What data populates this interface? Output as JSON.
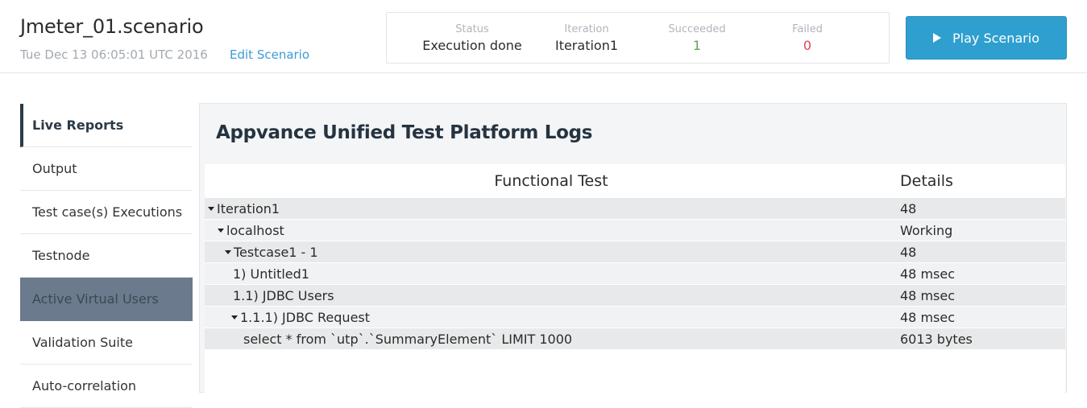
{
  "header": {
    "scenario_title": "Jmeter_01.scenario",
    "scenario_date": "Tue Dec 13 06:05:01 UTC 2016",
    "edit_label": "Edit Scenario",
    "play_label": "Play Scenario",
    "stats": {
      "status_label": "Status",
      "status_value": "Execution done",
      "iteration_label": "Iteration",
      "iteration_value": "Iteration1",
      "succeeded_label": "Succeeded",
      "succeeded_value": "1",
      "failed_label": "Failed",
      "failed_value": "0"
    }
  },
  "sidebar": {
    "items": [
      {
        "label": "Live Reports"
      },
      {
        "label": "Output"
      },
      {
        "label": "Test case(s) Executions"
      },
      {
        "label": "Testnode"
      },
      {
        "label": "Active Virtual Users"
      },
      {
        "label": "Validation Suite"
      },
      {
        "label": "Auto-correlation"
      }
    ]
  },
  "panel": {
    "title": "Appvance Unified Test Platform Logs",
    "columns": [
      "Functional Test",
      "Details"
    ],
    "rows": [
      {
        "name": "Iteration1",
        "details": "48"
      },
      {
        "name": "localhost",
        "details": "Working"
      },
      {
        "name": "Testcase1 - 1",
        "details": "48"
      },
      {
        "name": "1) Untitled1",
        "details": "48 msec"
      },
      {
        "name": "1.1) JDBC Users",
        "details": "48 msec"
      },
      {
        "name": "1.1.1) JDBC Request",
        "details": "48 msec"
      },
      {
        "name": "select * from `utp`.`SummaryElement` LIMIT 1000",
        "details": "6013 bytes"
      }
    ]
  },
  "colors": {
    "accent": "#2e9fcf",
    "link": "#3b9bd6",
    "success": "#5aa55a",
    "failure": "#e0445a",
    "sidebar_selected": "#6b7a8c"
  }
}
